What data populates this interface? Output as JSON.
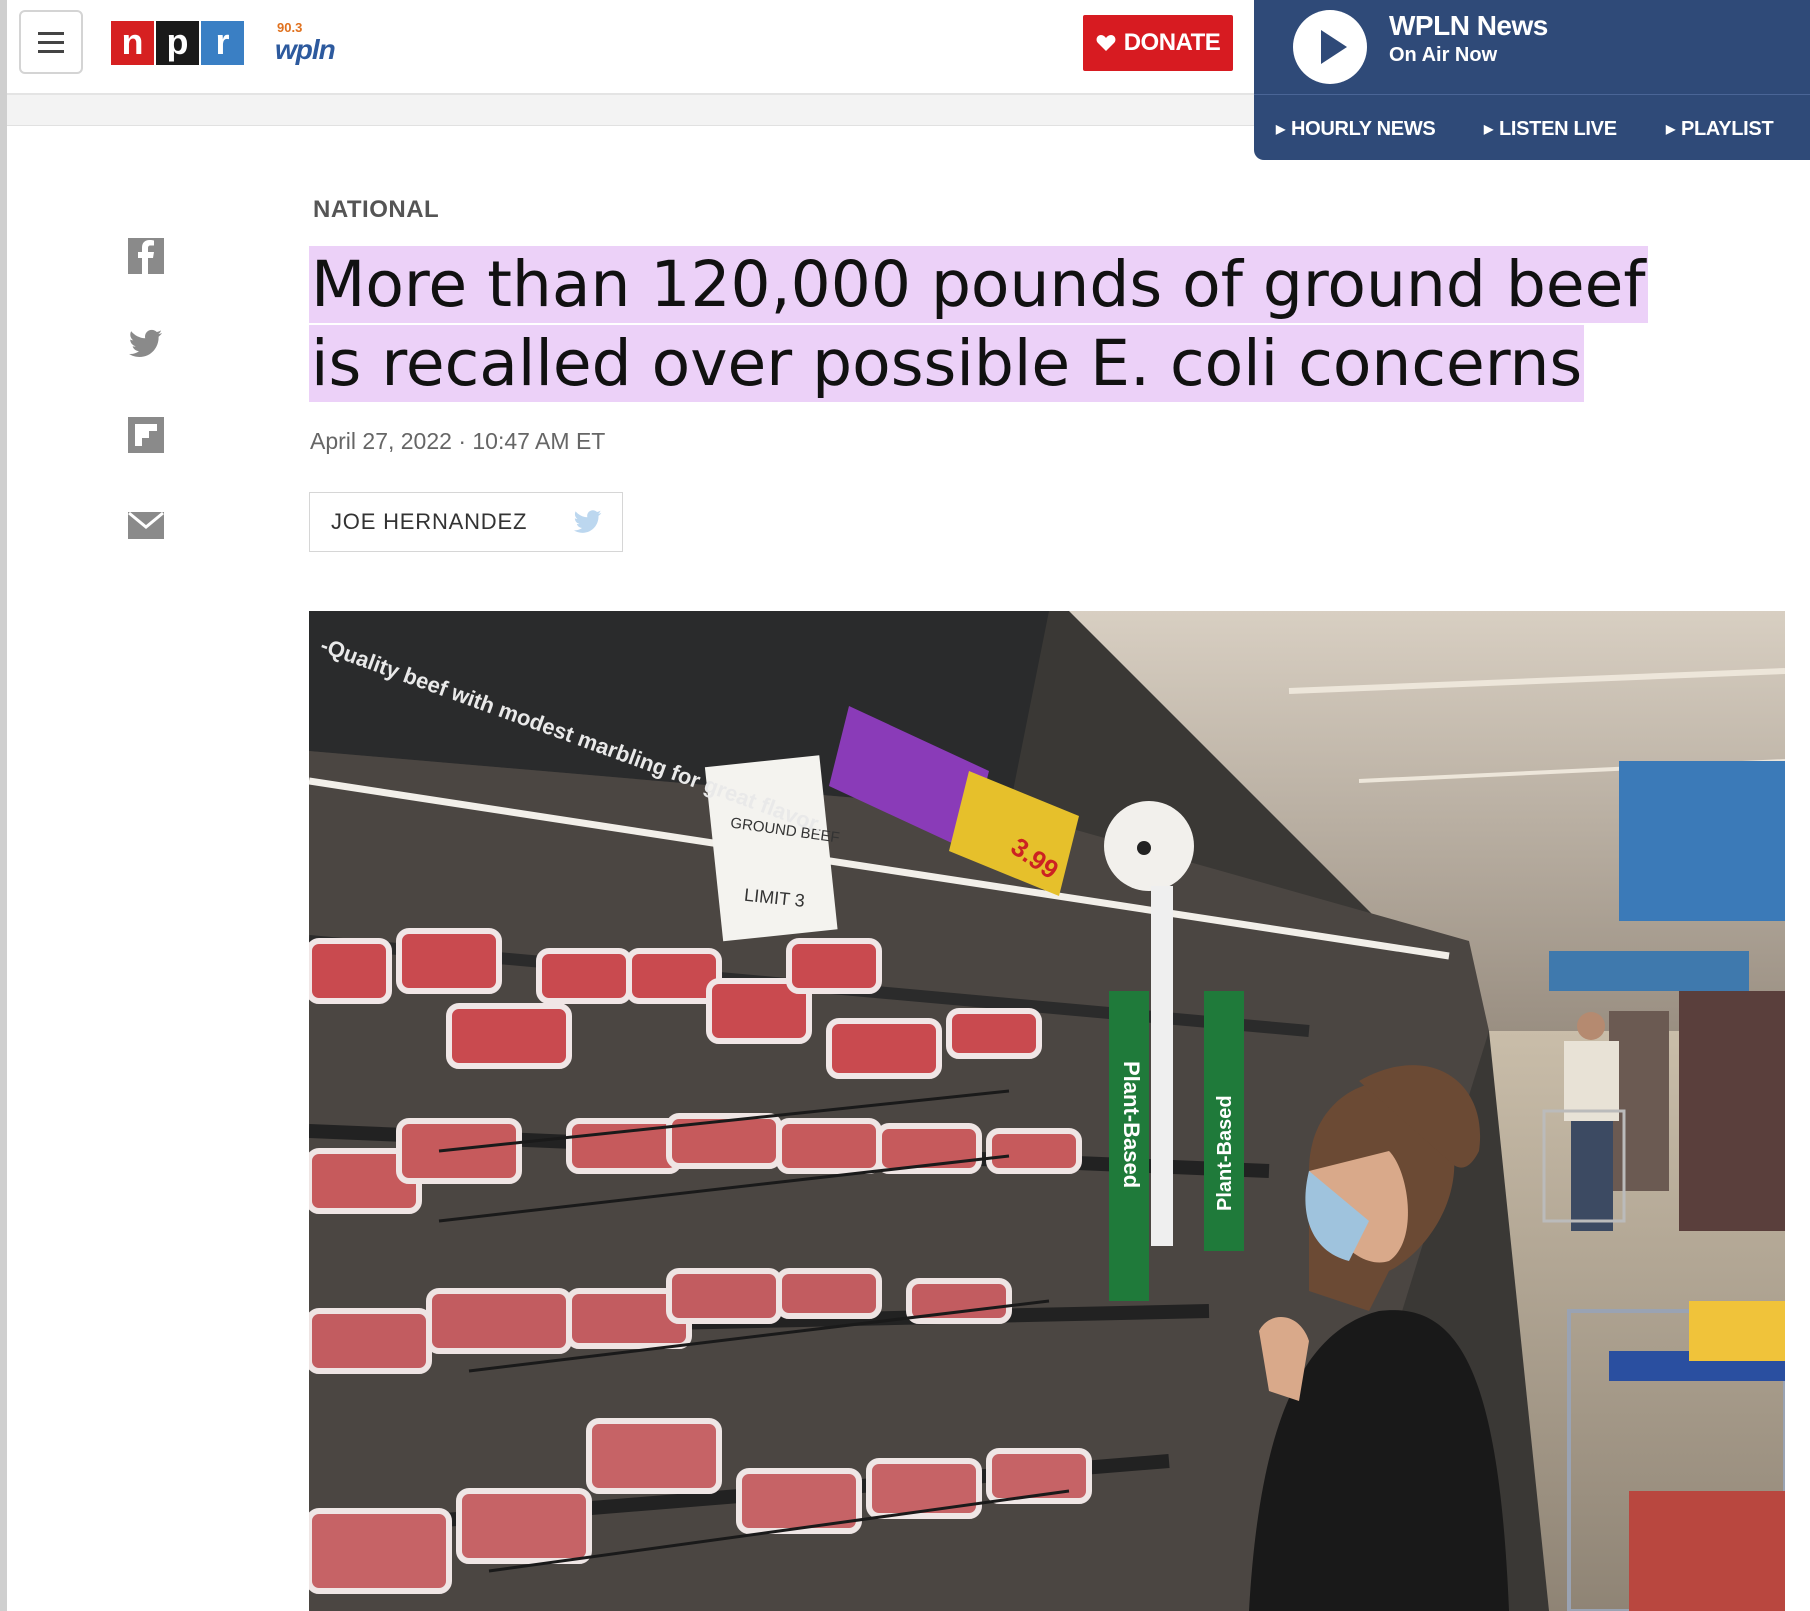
{
  "header": {
    "menu_label": "Menu",
    "npr_letters": [
      "n",
      "p",
      "r"
    ],
    "station_logo_number": "90.3",
    "station_logo_name": "wpln",
    "donate_label": "DONATE"
  },
  "player": {
    "title": "WPLN News",
    "subtitle": "On Air Now",
    "links": [
      "HOURLY NEWS",
      "LISTEN LIVE",
      "PLAYLIST"
    ]
  },
  "share": {
    "icons": [
      "facebook-icon",
      "twitter-icon",
      "flipboard-icon",
      "email-icon"
    ]
  },
  "article": {
    "section": "NATIONAL",
    "headline_line1": "More than 120,000 pounds of ground beef",
    "headline_line2": "is recalled over possible E. coli concerns",
    "dateline": "April 27, 2022 · 10:47 AM ET",
    "author": "JOE HERNANDEZ"
  },
  "photo": {
    "sign_text": "GROUND BEEF",
    "sign_limit": "LIMIT 3",
    "banner_text": "-Quality beef with modest marbling for great flavor.",
    "tag_left": "Plant-Based",
    "tag_right": "Plant-Based",
    "price_tag": "3.99"
  },
  "colors": {
    "npr_red": "#d62021",
    "npr_black": "#1a1a1a",
    "npr_blue": "#3a7fc4",
    "donate_red": "#d71b21",
    "player_blue": "#2f4a78",
    "headline_highlight": "#ecd1f8"
  }
}
